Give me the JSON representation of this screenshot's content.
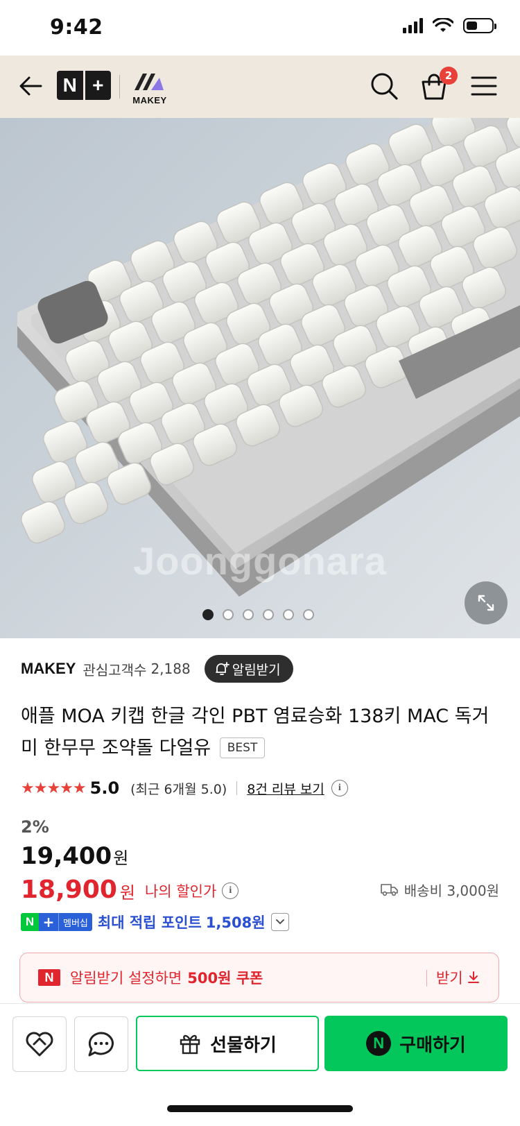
{
  "status_bar": {
    "time": "9:42"
  },
  "header": {
    "npay_logo": {
      "left": "N",
      "right": "+"
    },
    "brand_logo": "MAKEY",
    "cart_count": "2",
    "icons": [
      "back-arrow-icon",
      "search-icon",
      "cart-icon",
      "menu-icon"
    ]
  },
  "product_image": {
    "watermark": "Joonggonara",
    "slide_count": 6,
    "active_slide": 1
  },
  "seller": {
    "name": "MAKEY",
    "fans_label": "관심고객수",
    "fans_count": "2,188",
    "notify_label": "알림받기"
  },
  "product": {
    "title": "애플 MOA 키캡 한글 각인 PBT 염료승화 138키 MAC 독거미 한무무 조약돌 다얼유",
    "badge": "BEST"
  },
  "rating": {
    "stars": "★★★★★",
    "value": "5.0",
    "recent": "(최근 6개월 5.0)",
    "review_link": "8건 리뷰 보기",
    "info": "i"
  },
  "price": {
    "discount": "2%",
    "original": "19,400",
    "currency": "원",
    "sale": "18,900",
    "sale_label": "나의 할인가",
    "shipping": "배송비 3,000원"
  },
  "membership": {
    "badge_n": "N",
    "badge_plus": "+",
    "badge_text": "멤버십",
    "text": "최대 적립 포인트",
    "points": "1,508원"
  },
  "coupon": {
    "n_mark": "N",
    "text": "알림받기 설정하면",
    "highlight": "500원 쿠폰",
    "action": "받기"
  },
  "bottom_bar": {
    "gift_label": "선물하기",
    "buy_label": "구매하기",
    "buy_mark": "N"
  },
  "colors": {
    "header_bg": "#efe8df",
    "accent_red": "#e0252e",
    "naver_green": "#03c75a",
    "member_blue": "#2a60d8"
  }
}
